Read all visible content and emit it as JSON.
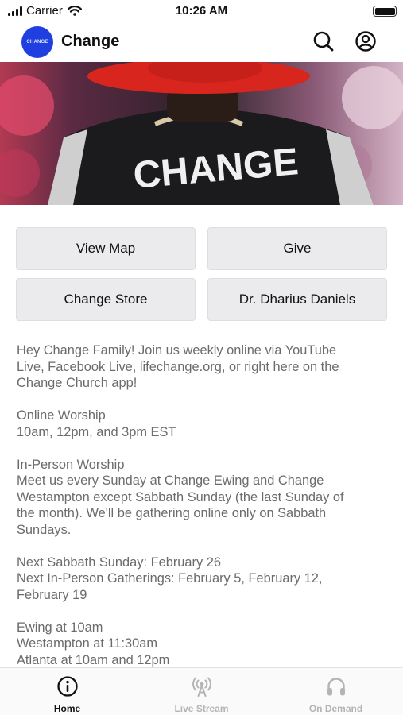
{
  "status_bar": {
    "carrier": "Carrier",
    "time": "10:26 AM"
  },
  "header": {
    "logo_text": "CHANGE",
    "title": "Change",
    "icons": [
      "search-icon",
      "account-icon"
    ]
  },
  "hero": {
    "jacket_text": "CHANGE"
  },
  "actions": [
    {
      "label": "View Map"
    },
    {
      "label": "Give"
    },
    {
      "label": "Change Store"
    },
    {
      "label": "Dr. Dharius Daniels"
    }
  ],
  "content": {
    "intro": [
      "Hey Change Family! Join us weekly online via YouTube",
      "Live, Facebook Live, lifechange.org, or right here on the",
      "Change Church app!"
    ],
    "online_worship": [
      "Online Worship",
      "10am, 12pm, and 3pm EST"
    ],
    "in_person_worship": [
      "In-Person Worship",
      "Meet us every Sunday at Change Ewing and Change",
      "Westampton except Sabbath Sunday (the last Sunday of",
      "the month). We'll be gathering online only on Sabbath",
      "Sundays."
    ],
    "dates": [
      "Next Sabbath Sunday: February 26",
      "Next In-Person Gatherings: February 5, February 12,",
      "February 19"
    ],
    "locations": [
      "Ewing at 10am",
      "Westampton at 11:30am",
      "Atlanta at 10am and 12pm"
    ]
  },
  "tabs": [
    {
      "label": "Home",
      "icon": "info-icon",
      "active": true
    },
    {
      "label": "Live Stream",
      "icon": "broadcast-icon",
      "active": false
    },
    {
      "label": "On Demand",
      "icon": "headphones-icon",
      "active": false
    }
  ],
  "colors": {
    "logo_blue": "#1f3fe0",
    "button_bg": "#ebebed",
    "body_text": "#6b6b6b",
    "tab_inactive": "#b4b4b4",
    "hat_red": "#d8261f"
  }
}
